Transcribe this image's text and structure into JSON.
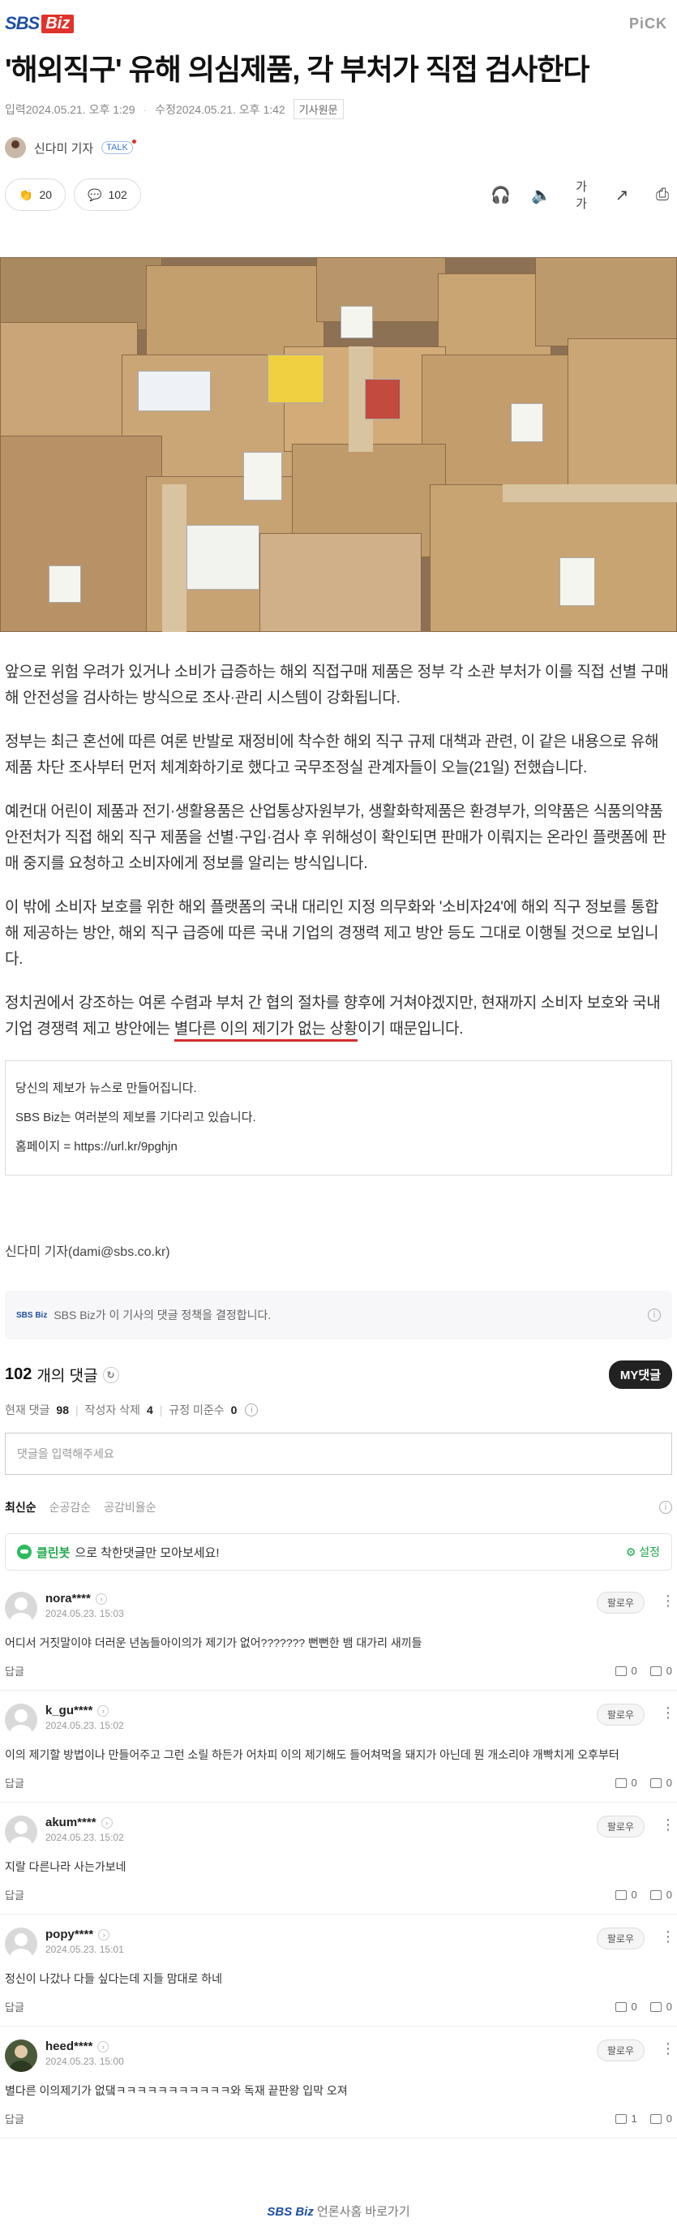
{
  "header": {
    "logo_sbs": "SBS",
    "logo_biz": "Biz",
    "pick": "PiCK"
  },
  "article": {
    "title": "'해외직구' 유해 의심제품, 각 부처가 직접 검사한다",
    "input_date": "입력2024.05.21. 오후 1:29",
    "edit_date": "수정2024.05.21. 오후 1:42",
    "origin_label": "기사원문",
    "reporter": "신다미 기자",
    "talk_label": "TALK",
    "reaction_count": "20",
    "comment_count": "102",
    "paragraphs": [
      "앞으로 위험 우려가 있거나 소비가 급증하는 해외 직접구매 제품은 정부 각 소관 부처가 이를 직접 선별 구매해 안전성을 검사하는 방식으로 조사·관리 시스템이 강화됩니다.",
      "정부는 최근 혼선에 따른 여론 반발로 재정비에 착수한 해외 직구 규제 대책과 관련, 이 같은 내용으로 유해제품 차단 조사부터 먼저 체계화하기로 했다고 국무조정실 관계자들이 오늘(21일) 전했습니다.",
      "예컨대 어린이 제품과 전기·생활용품은 산업통상자원부가, 생활화학제품은 환경부가, 의약품은 식품의약품안전처가 직접 해외 직구 제품을 선별·구입·검사 후 위해성이 확인되면 판매가 이뤄지는 온라인 플랫폼에 판매 중지를 요청하고 소비자에게 정보를 알리는 방식입니다.",
      "이 밖에 소비자 보호를 위한 해외 플랫폼의 국내 대리인 지정 의무화와 '소비자24'에 해외 직구 정보를 통합해 제공하는 방안, 해외 직구 급증에 따른 국내 기업의 경쟁력 제고 방안 등도 그대로 이행될 것으로 보입니다."
    ],
    "last_paragraph_a": "정치권에서 강조하는 여론 수렴과 부처 간 협의 절차를 향후에 거쳐야겠지만, 현재까지 소비자 보호와 국내 기업 경쟁력 제고 방안에는 ",
    "last_paragraph_highlight": "별다른 이의 제기가 없는 상황",
    "last_paragraph_b": "이기 때문입니다.",
    "tip_lines": [
      "당신의 제보가 뉴스로 만들어집니다.",
      "SBS Biz는 여러분의 제보를 기다리고 있습니다.",
      "홈페이지 = https://url.kr/9pghjn"
    ],
    "byline": "신다미 기자(dami@sbs.co.kr)"
  },
  "comments_section": {
    "policy_logo": "SBS Biz",
    "policy_text": "SBS Biz가 이 기사의 댓글 정책을 결정합니다.",
    "total": "102",
    "total_unit": "개의 댓글",
    "my_comments": "MY댓글",
    "current_label": "현재 댓글",
    "current_value": "98",
    "deleted_author_label": "작성자 삭제",
    "deleted_author_value": "4",
    "deleted_policy_label": "규정 미준수",
    "deleted_policy_value": "0",
    "input_placeholder": "댓글을 입력해주세요",
    "sort_tabs": [
      "최신순",
      "순공감순",
      "공감비율순"
    ],
    "cleanbot_name": "클린봇",
    "cleanbot_text": "으로 착한댓글만 모아보세요!",
    "cleanbot_settings": "설정",
    "follow_label": "팔로우",
    "reply_label": "답글",
    "items": [
      {
        "nick": "nora****",
        "date": "2024.05.23. 15:03",
        "text": "어디서 거짓말이야 더러운 년놈들아이의가 제기가 없어??????? 뻔뻔한 뱀 대가리 새끼들",
        "up": "0",
        "down": "0"
      },
      {
        "nick": "k_gu****",
        "date": "2024.05.23. 15:02",
        "text": "이의 제기할 방법이나 만들어주고 그런 소릴 하든가 어차피 이의 제기해도 들어쳐먹을 돼지가 아닌데 뭔 개소리야 개빡치게 오후부터",
        "up": "0",
        "down": "0"
      },
      {
        "nick": "akum****",
        "date": "2024.05.23. 15:02",
        "text": "지랄 다른나라 사는가보네",
        "up": "0",
        "down": "0"
      },
      {
        "nick": "popy****",
        "date": "2024.05.23. 15:01",
        "text": "정신이 나갔나 다들 싶다는데 지들 맘대로 하네",
        "up": "0",
        "down": "0"
      },
      {
        "nick": "heed****",
        "date": "2024.05.23. 15:00",
        "text": "별다른 이의제기가 없댘ㅋㅋㅋㅋㅋㅋㅋㅋㅋㅋㅋ와 독재 끝판왕 입막 오져",
        "up": "1",
        "down": "0"
      }
    ],
    "footer_logo": "SBS Biz",
    "footer_text": "언론사홈 바로가기"
  }
}
